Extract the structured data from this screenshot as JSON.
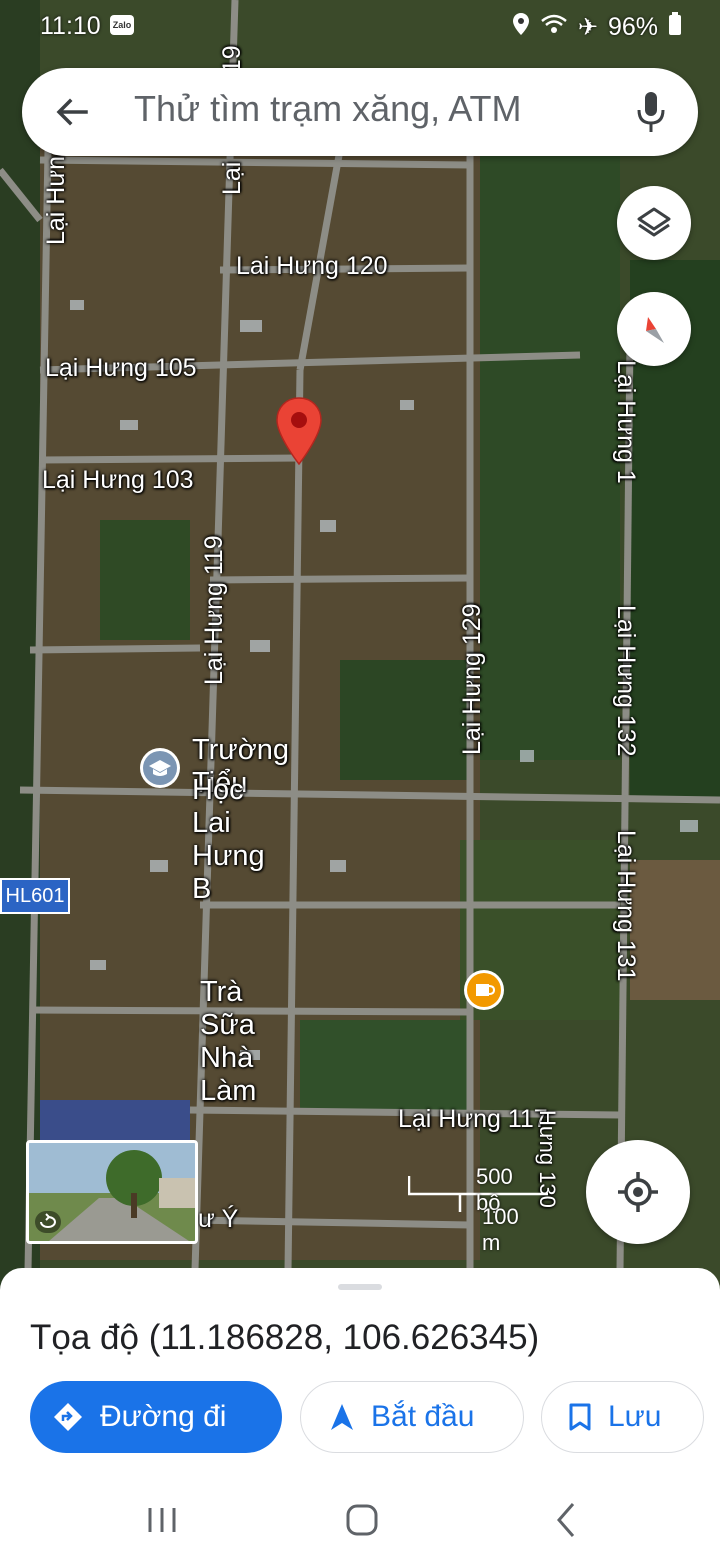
{
  "status_bar": {
    "time": "11:10",
    "zalo_badge": "Zalo",
    "battery": "96%"
  },
  "search": {
    "placeholder": "Thử tìm trạm xăng, ATM"
  },
  "map": {
    "road_labels": [
      {
        "text": "Lại Hưng",
        "id": "road-lai-hung-left"
      },
      {
        "text": "Lại Hưng 119",
        "id": "road-lai-hung-119-top"
      },
      {
        "text": "Lai Hưng 120",
        "id": "road-lai-hung-120"
      },
      {
        "text": "Lại Hưng 105",
        "id": "road-lai-hung-105"
      },
      {
        "text": "Lại Hưng 103",
        "id": "road-lai-hung-103"
      },
      {
        "text": "Lại Hưng 119",
        "id": "road-lai-hung-119"
      },
      {
        "text": "Lại Hưng 129",
        "id": "road-lai-hung-129"
      },
      {
        "text": "Lại Hưng 132",
        "id": "road-lai-hung-132"
      },
      {
        "text": "Lại Hưng 131",
        "id": "road-lai-hung-131"
      },
      {
        "text": "Lại Hưng 1",
        "id": "road-lai-hung-1-right"
      },
      {
        "text": "Lại Hưng 117",
        "id": "road-lai-hung-117"
      },
      {
        "text": "ư Ý",
        "id": "road-u-y"
      },
      {
        "text": "Hưng 130",
        "id": "road-hung-130"
      }
    ],
    "pois": {
      "school_line1": "Trường Tiểu",
      "school_line2": "Học Lai Hưng B",
      "cafe": "Trà Sữa Nhà Làm"
    },
    "route_badge": "HL601",
    "scale": {
      "top": "500 bộ",
      "bottom": "100 m"
    }
  },
  "sheet": {
    "coordinates": "Tọa độ (11.186828, 106.626345)",
    "directions_label": "Đường đi",
    "start_label": "Bắt đầu",
    "save_label": "Lưu"
  },
  "colors": {
    "accent": "#1a73e8",
    "pin": "#ea4335",
    "poi_school": "#5f7da0",
    "poi_cafe": "#f29900"
  }
}
